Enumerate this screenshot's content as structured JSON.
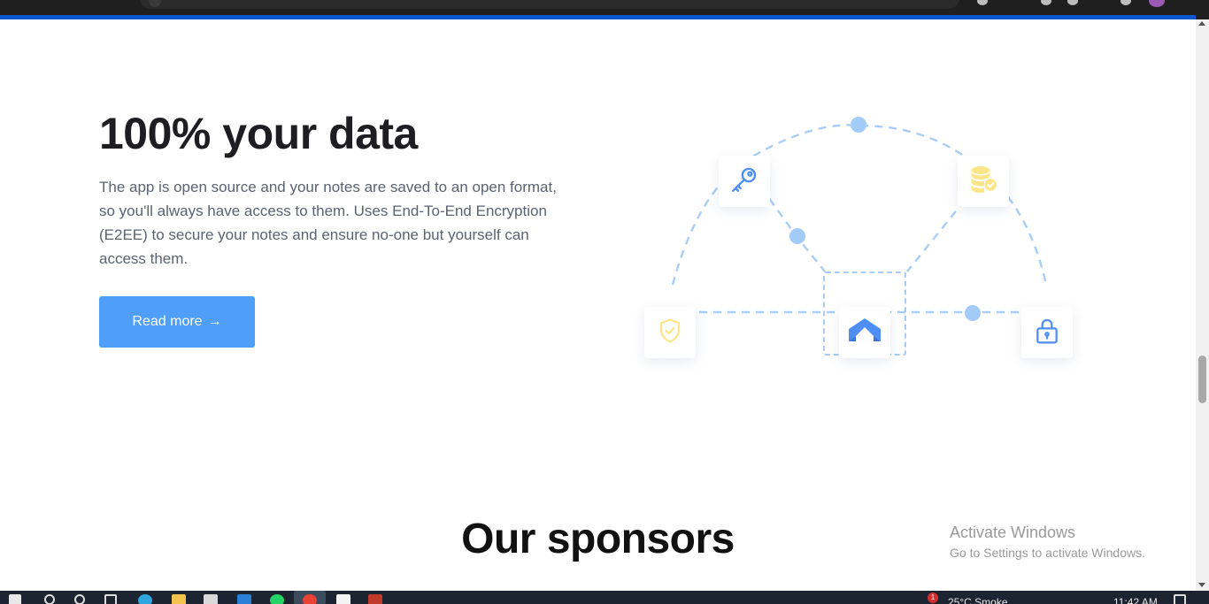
{
  "hero": {
    "title_plain": "100%",
    "title_highlight": "your data",
    "description": "The app is open source and your notes are saved to an open format, so you'll always have access to them. Uses End-To-End Encryption (E2EE) to secure your notes and ensure no-one but yourself can access them.",
    "button_label": "Read more",
    "button_arrow": "→"
  },
  "sponsors": {
    "title_plain": "Our",
    "title_highlight": "sponsors"
  },
  "watermark": {
    "line1": "Activate Windows",
    "line2": "Go to Settings to activate Windows."
  },
  "taskbar": {
    "weather": "25°C  Smoke",
    "time": "11:42 AM",
    "notification_count": "1"
  },
  "colors": {
    "accent": "#4f9ef8",
    "highlight": "#fde68a",
    "dash": "#a9cdf5",
    "dot": "#a3cbf7",
    "icon_blue": "#4f8ff5",
    "icon_yellow": "#fde68a"
  },
  "icons": [
    "key-icon",
    "database-check-icon",
    "shield-check-icon",
    "app-logo-icon",
    "lock-icon"
  ]
}
